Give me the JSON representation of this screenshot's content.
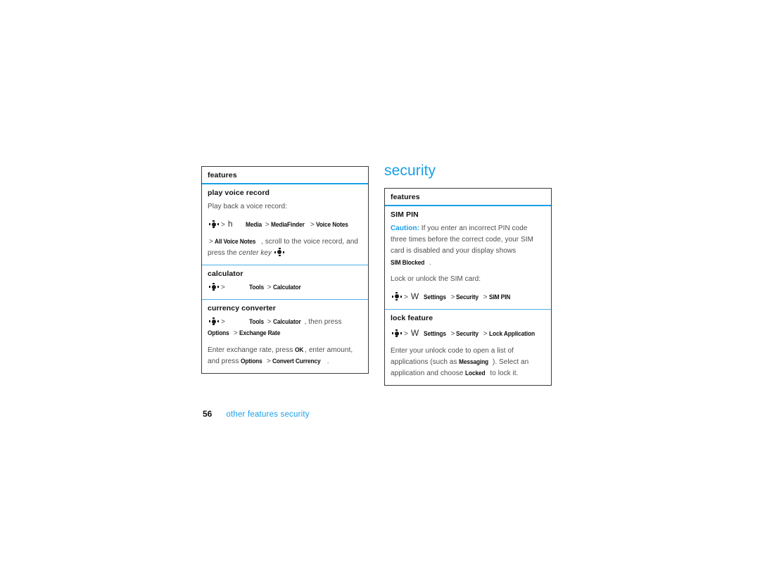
{
  "document": {
    "page_number": "56",
    "breadcrumb": "other  features security",
    "accent_color": "#189fe8",
    "body_text_color": "#4d4d4d",
    "border_color": "#3d3d3d"
  },
  "left_column": {
    "table": {
      "header": "features",
      "rows": [
        {
          "title": "play voice record",
          "blocks": [
            {
              "kind": "text",
              "text": "Play back a voice record:"
            },
            {
              "kind": "path",
              "parts": [
                {
                  "type": "centerkey"
                },
                {
                  "type": "sep",
                  "text": ">"
                },
                {
                  "type": "iconfont",
                  "text": "h"
                },
                {
                  "type": "gap"
                },
                {
                  "type": "menu",
                  "text": "Media"
                },
                {
                  "type": "sep",
                  "text": ">"
                },
                {
                  "type": "menu",
                  "text": "MediaFinder"
                },
                {
                  "type": "sep",
                  "text": ">"
                },
                {
                  "type": "menu",
                  "text": "Voice Notes"
                }
              ]
            },
            {
              "kind": "mixed",
              "parts": [
                {
                  "type": "sep",
                  "text": ">"
                },
                {
                  "type": "menu",
                  "text": "All Voice Notes"
                },
                {
                  "type": "text",
                  "text": ", scroll to the voice record, and press the "
                },
                {
                  "type": "italic",
                  "text": "center key"
                },
                {
                  "type": "space"
                },
                {
                  "type": "centerkey"
                }
              ]
            }
          ]
        },
        {
          "title": "calculator",
          "blocks": [
            {
              "kind": "path",
              "parts": [
                {
                  "type": "centerkey"
                },
                {
                  "type": "sep",
                  "text": ">"
                },
                {
                  "type": "gap"
                },
                {
                  "type": "gap"
                },
                {
                  "type": "menu",
                  "text": "Tools"
                },
                {
                  "type": "sep",
                  "text": ">"
                },
                {
                  "type": "menu",
                  "text": "Calculator"
                }
              ]
            }
          ]
        },
        {
          "title": "currency converter",
          "blocks": [
            {
              "kind": "mixed",
              "parts": [
                {
                  "type": "centerkey"
                },
                {
                  "type": "sep",
                  "text": ">"
                },
                {
                  "type": "gap"
                },
                {
                  "type": "gap"
                },
                {
                  "type": "menu",
                  "text": "Tools"
                },
                {
                  "type": "sep",
                  "text": ">"
                },
                {
                  "type": "menu",
                  "text": "Calculator"
                },
                {
                  "type": "text",
                  "text": ", then press "
                },
                {
                  "type": "break"
                },
                {
                  "type": "menu",
                  "text": "Options"
                },
                {
                  "type": "sep",
                  "text": ">"
                },
                {
                  "type": "menu",
                  "text": "Exchange Rate"
                }
              ]
            },
            {
              "kind": "mixed",
              "parts": [
                {
                  "type": "text",
                  "text": "Enter exchange rate, press "
                },
                {
                  "type": "menu",
                  "text": "OK"
                },
                {
                  "type": "text",
                  "text": ", enter amount, and press "
                },
                {
                  "type": "menu",
                  "text": "Options"
                },
                {
                  "type": "sep",
                  "text": ">"
                },
                {
                  "type": "menu",
                  "text": "Convert Currency"
                },
                {
                  "type": "text",
                  "text": "."
                }
              ]
            }
          ]
        }
      ]
    }
  },
  "right_column": {
    "heading": "security",
    "table": {
      "header": "features",
      "rows": [
        {
          "title": "SIM PIN",
          "blocks": [
            {
              "kind": "mixed",
              "parts": [
                {
                  "type": "caution",
                  "text": "Caution:"
                },
                {
                  "type": "text",
                  "text": " If you enter an incorrect PIN code three times before the correct code, your SIM card is disabled and your display shows "
                },
                {
                  "type": "menu",
                  "text": "SIM Blocked"
                },
                {
                  "type": "text",
                  "text": "."
                }
              ]
            },
            {
              "kind": "text",
              "text": "Lock or unlock the SIM card:"
            },
            {
              "kind": "path",
              "parts": [
                {
                  "type": "centerkey"
                },
                {
                  "type": "sep",
                  "text": ">"
                },
                {
                  "type": "iconfont",
                  "text": "W"
                },
                {
                  "type": "gap-sm"
                },
                {
                  "type": "menu",
                  "text": "Settings"
                },
                {
                  "type": "sep",
                  "text": ">"
                },
                {
                  "type": "menu",
                  "text": "Security"
                },
                {
                  "type": "sep",
                  "text": ">"
                },
                {
                  "type": "menu",
                  "text": "SIM PIN"
                }
              ]
            }
          ]
        },
        {
          "title": "lock feature",
          "blocks": [
            {
              "kind": "path",
              "parts": [
                {
                  "type": "centerkey"
                },
                {
                  "type": "sep",
                  "text": ">"
                },
                {
                  "type": "iconfont",
                  "text": "W"
                },
                {
                  "type": "gap-sm"
                },
                {
                  "type": "menu",
                  "text": "Settings"
                },
                {
                  "type": "sep",
                  "text": ">"
                },
                {
                  "type": "menu",
                  "text": "Security"
                },
                {
                  "type": "sep",
                  "text": ">"
                },
                {
                  "type": "menu",
                  "text": "Lock Application"
                }
              ]
            },
            {
              "kind": "mixed",
              "parts": [
                {
                  "type": "text",
                  "text": "Enter your unlock code to open a list of applications (such as "
                },
                {
                  "type": "menu",
                  "text": "Messaging"
                },
                {
                  "type": "text",
                  "text": "). Select an application and choose "
                },
                {
                  "type": "menu",
                  "text": "Locked"
                },
                {
                  "type": "text",
                  "text": " to lock it."
                }
              ]
            }
          ]
        }
      ]
    }
  }
}
